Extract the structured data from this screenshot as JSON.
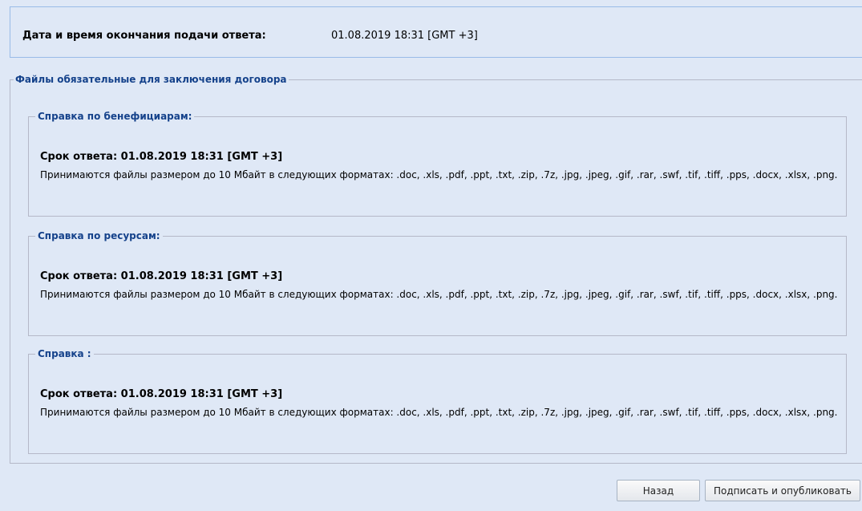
{
  "header": {
    "deadline_label": "Дата и время окончания подачи ответа:",
    "deadline_value": "01.08.2019 18:31 [GMT +3]"
  },
  "required_files": {
    "legend": "Файлы обязательные для заключения договора",
    "sections": [
      {
        "legend": "Справка по бенефициарам:",
        "due": "Срок ответа: 01.08.2019 18:31 [GMT +3]",
        "note": "Принимаются файлы размером до 10 Мбайт в следующих форматах: .doc, .xls, .pdf, .ppt, .txt, .zip, .7z, .jpg, .jpeg, .gif, .rar, .swf, .tif, .tiff, .pps, .docx, .xlsx, .png."
      },
      {
        "legend": "Справка по ресурсам:",
        "due": "Срок ответа: 01.08.2019 18:31 [GMT +3]",
        "note": "Принимаются файлы размером до 10 Мбайт в следующих форматах: .doc, .xls, .pdf, .ppt, .txt, .zip, .7z, .jpg, .jpeg, .gif, .rar, .swf, .tif, .tiff, .pps, .docx, .xlsx, .png."
      },
      {
        "legend": "Справка :",
        "due": "Срок ответа: 01.08.2019 18:31 [GMT +3]",
        "note": "Принимаются файлы размером до 10 Мбайт в следующих форматах: .doc, .xls, .pdf, .ppt, .txt, .zip, .7z, .jpg, .jpeg, .gif, .rar, .swf, .tif, .tiff, .pps, .docx, .xlsx, .png."
      }
    ]
  },
  "buttons": {
    "back": "Назад",
    "sign_publish": "Подписать и опубликовать"
  }
}
